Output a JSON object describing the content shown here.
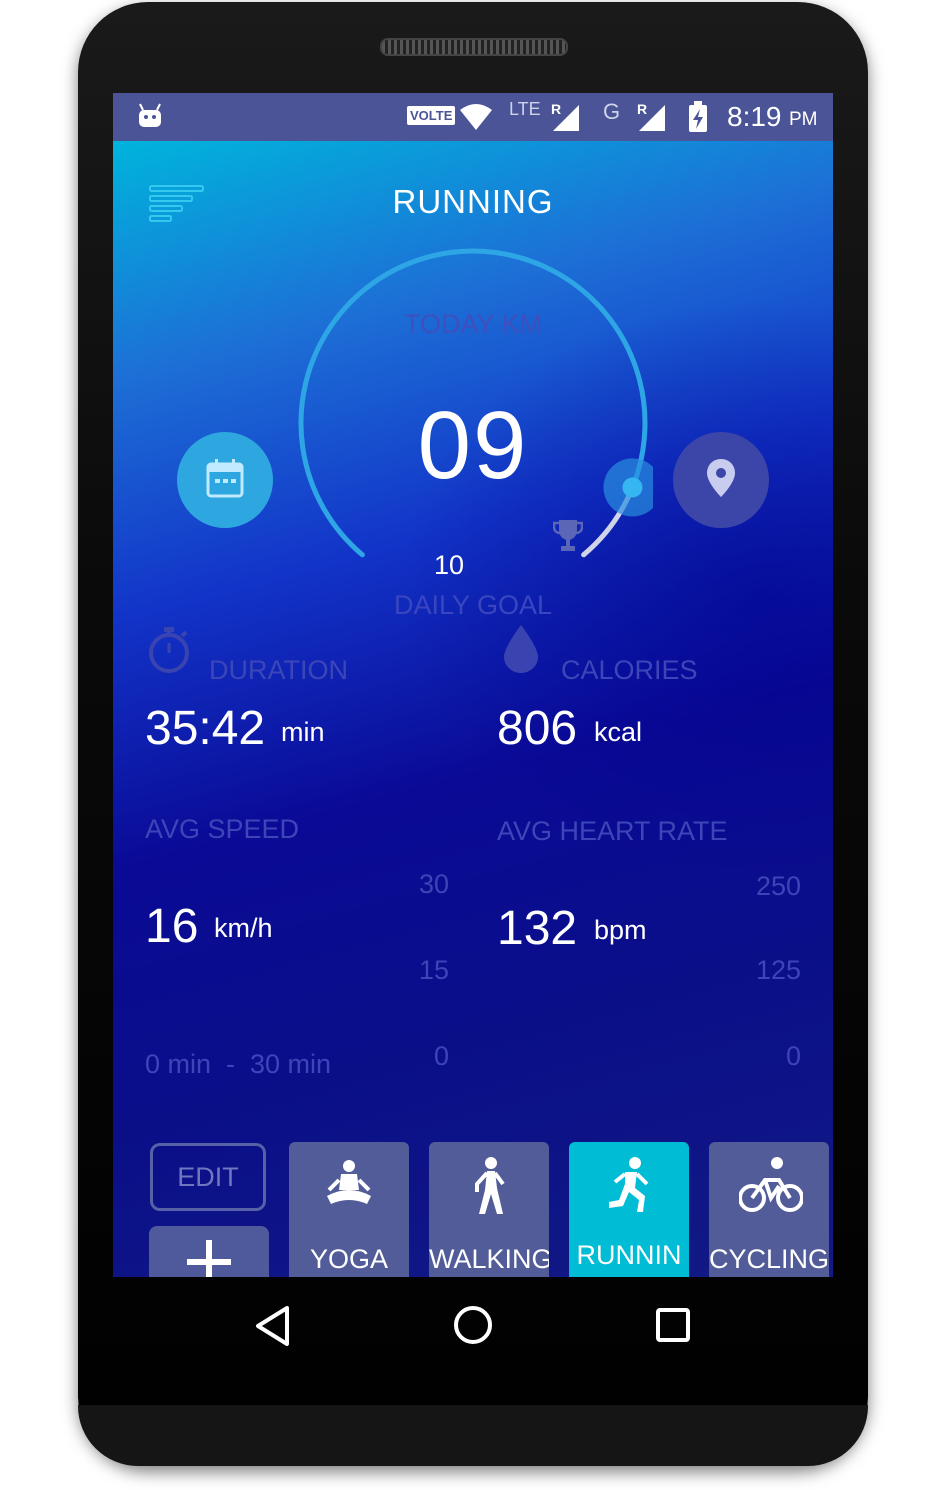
{
  "status_bar": {
    "time": "8:19",
    "ampm": "PM",
    "volte": "VOLTE",
    "lte": "LTE",
    "g": "G",
    "roaming_1": "R",
    "roaming_2": "R",
    "icons": [
      "android-debug-icon",
      "wifi-icon",
      "signal-icon",
      "signal-icon",
      "battery-charging-icon"
    ]
  },
  "header": {
    "title": "RUNNING",
    "menu_icon": "menu-icon"
  },
  "gauge": {
    "label": "TODAY KM",
    "value": "09",
    "goal_value": "10",
    "goal_label": "DAILY GOAL",
    "progress_fraction": 0.9,
    "left_button_icon": "calendar-icon",
    "right_button_icon": "location-pin-icon",
    "goal_icon": "trophy-icon"
  },
  "stats": {
    "duration": {
      "label": "DURATION",
      "value": "35:42",
      "unit": "min",
      "icon": "stopwatch-icon"
    },
    "calories": {
      "label": "CALORIES",
      "value": "806",
      "unit": "kcal",
      "icon": "drop-icon"
    },
    "avg_speed": {
      "label": "AVG SPEED",
      "value": "16",
      "unit": "km/h",
      "ticks": [
        "30",
        "15",
        "0"
      ],
      "range": "0 min  -  30 min"
    },
    "avg_heart_rate": {
      "label": "AVG HEART RATE",
      "value": "132",
      "unit": "bpm",
      "ticks": [
        "250",
        "125",
        "0"
      ]
    }
  },
  "activities": {
    "edit_label": "EDIT",
    "add_icon": "plus-icon",
    "items": [
      {
        "name": "YOGA",
        "icon": "yoga-icon",
        "accent": "#1fd7f5"
      },
      {
        "name": "WALKING",
        "icon": "walking-icon",
        "accent": "#f9b234"
      },
      {
        "name": "RUNNING",
        "icon": "running-icon",
        "accent": "#a35bd6",
        "active": true
      },
      {
        "name": "CYCLING",
        "icon": "cycling-icon",
        "accent": "#ff3d7f"
      }
    ]
  },
  "nav": {
    "icons": [
      "back-icon",
      "home-icon",
      "recents-icon"
    ]
  },
  "colors": {
    "accent": "#00bcd4",
    "status_bar": "#4b5496"
  }
}
